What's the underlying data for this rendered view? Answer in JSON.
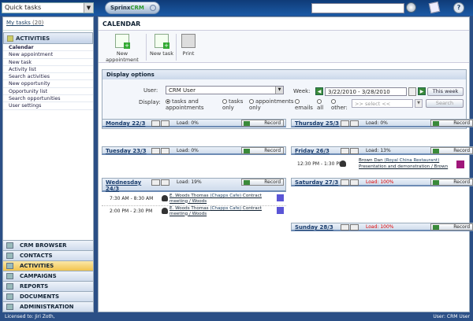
{
  "topbar": {
    "quick_tasks": "Quick tasks",
    "logo_prefix": "Sprinx",
    "logo_suffix": "CRM",
    "search_value": ""
  },
  "sidebar": {
    "my_tasks": "My tasks",
    "my_tasks_count": "(20)",
    "section": "ACTIVITIES",
    "items": [
      "Calendar",
      "New appointment",
      "New task",
      "Activity list",
      "Search activities",
      "New opportunity",
      "Opportunity list",
      "Search opportunities",
      "User settings"
    ],
    "nav": [
      "CRM BROWSER",
      "CONTACTS",
      "ACTIVITIES",
      "CAMPAIGNS",
      "REPORTS",
      "DOCUMENTS",
      "ADMINISTRATION"
    ]
  },
  "main": {
    "title": "CALENDAR",
    "toolbar": [
      "New appointment",
      "New task",
      "Print"
    ],
    "options": {
      "header": "Display options",
      "user_label": "User:",
      "user_value": "CRM User",
      "display_label": "Display:",
      "radios": [
        "tasks and appointments",
        "tasks only",
        "appointments only",
        "emails",
        "all",
        "other:"
      ],
      "week_label": "Week:",
      "week_value": "3/22/2010 - 3/28/2010",
      "this_week": "This week",
      "select_placeholder": ">> select <<",
      "search_button": "Search"
    },
    "days": {
      "mon": {
        "name": "Monday 22/3",
        "load": "Load: 0%",
        "record": "Record"
      },
      "tue": {
        "name": "Tuesday 23/3",
        "load": "Load: 0%",
        "record": "Record"
      },
      "wed": {
        "name": "Wednesday",
        "name2": "24/3",
        "load": "Load: 19%",
        "record": "Record",
        "events": [
          {
            "time": "7:30 AM - 8:30 AM",
            "person": "E. Woods Thomas",
            "company": "(Chapps Cafe)",
            "subject": "Contract",
            "subject2": "meeting / Woods"
          },
          {
            "time": "2:00 PM - 2:30 PM",
            "person": "E. Woods Thomas",
            "company": "(Chapps Cafe)",
            "subject": "Contract",
            "subject2": "meeting / Woods"
          }
        ]
      },
      "thu": {
        "name": "Thursday 25/3",
        "load": "Load: 0%",
        "record": "Record"
      },
      "fri": {
        "name": "Friday 26/3",
        "load": "Load: 13%",
        "record": "Record",
        "events": [
          {
            "time": "12:30 PM - 1:30 PM",
            "person": "Brown Dan",
            "company": "(Royal China Restaurant)",
            "subject": "Presentation and demonstration / Brown"
          }
        ]
      },
      "sat": {
        "name": "Saturday 27/3",
        "load": "Load: 100%",
        "record": "Record"
      },
      "sun": {
        "name": "Sunday 28/3",
        "load": "Load: 100%",
        "record": "Record"
      }
    }
  },
  "footer": {
    "licensed": "Licensed to: Jiri Zoth,",
    "user": "User: CRM User"
  },
  "colors": {
    "event_purple": "#5a55d6",
    "event_magenta": "#a0177a",
    "load_red": "#dd0000",
    "active_nav": "#f1c34e"
  }
}
